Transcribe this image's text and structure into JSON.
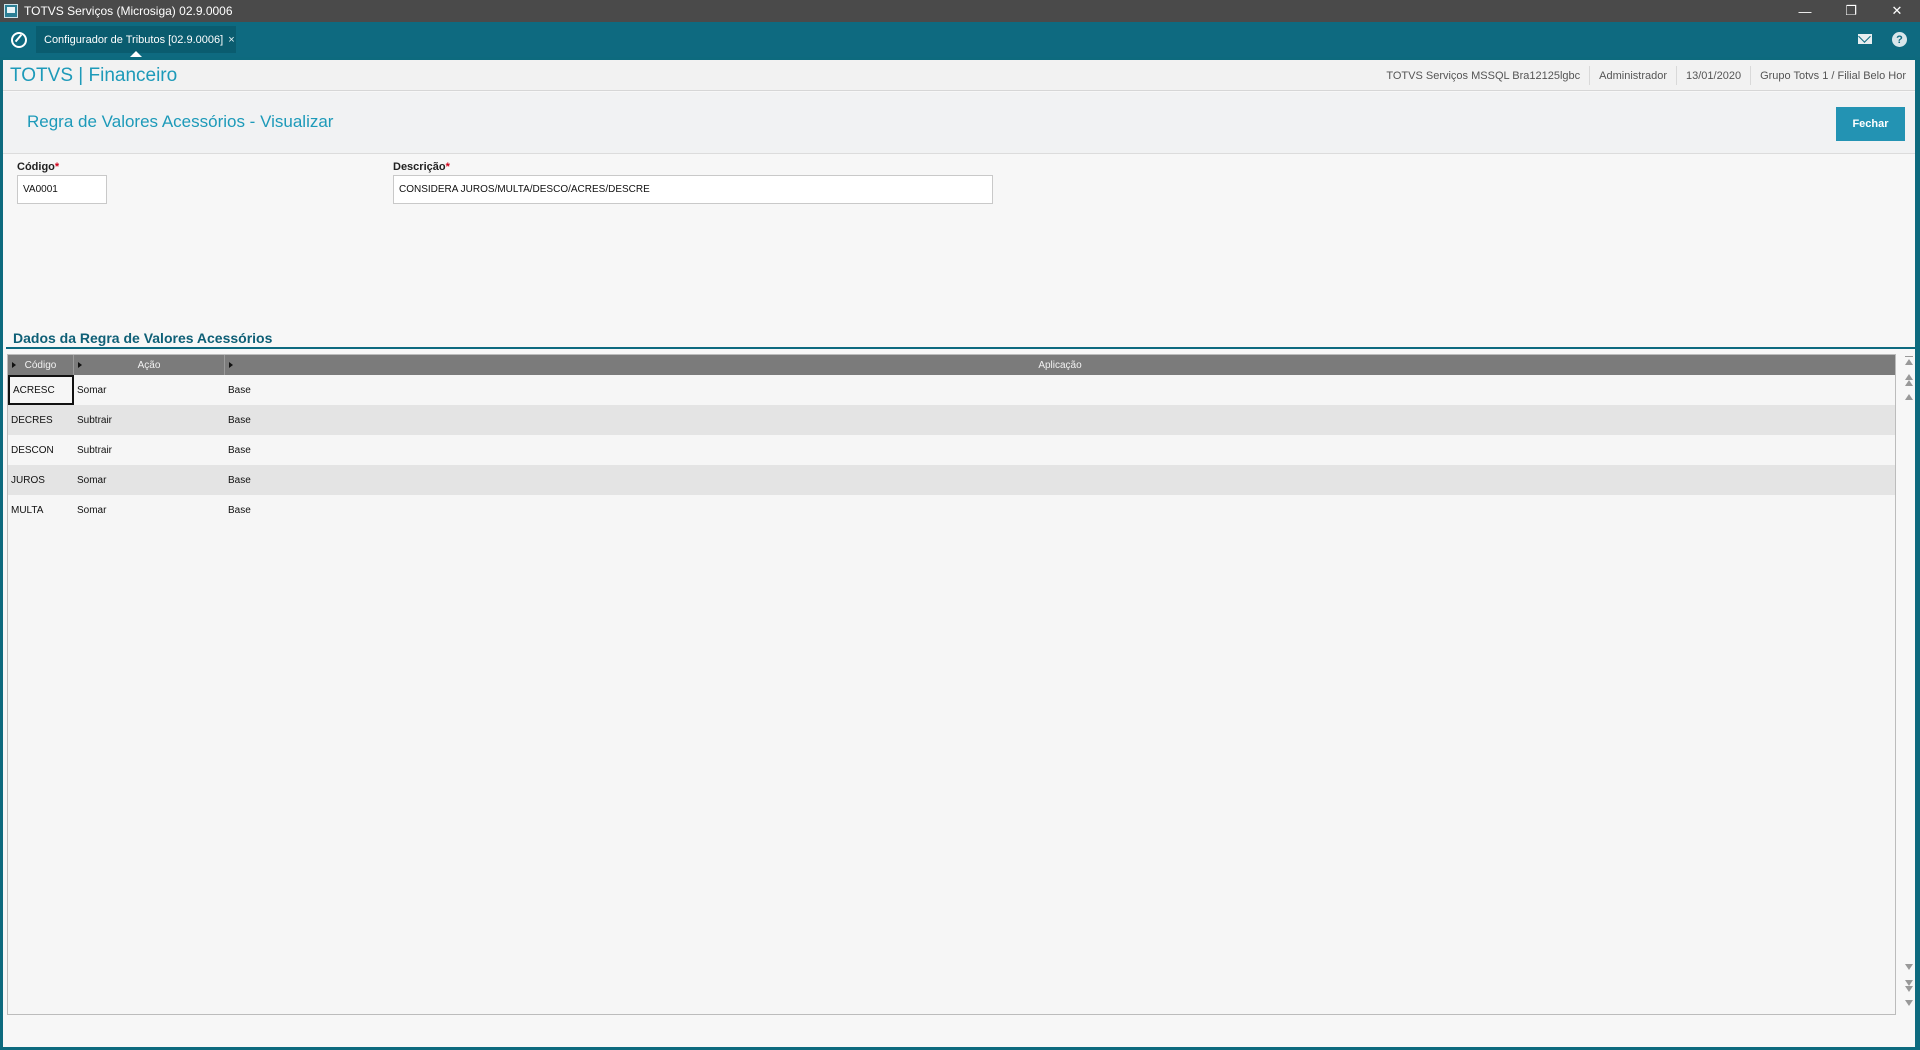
{
  "window": {
    "title": "TOTVS Serviços (Microsiga) 02.9.0006",
    "minimize": "—",
    "restore": "❐",
    "close": "✕"
  },
  "tabs": [
    {
      "label": "Configurador de Tributos [02.9.0006]",
      "close": "×"
    }
  ],
  "header": {
    "brand": "TOTVS | Financeiro",
    "environment": "TOTVS Serviços MSSQL Bra12125lgbc",
    "user": "Administrador",
    "date": "13/01/2020",
    "branch": "Grupo Totvs 1 / Filial Belo Hor"
  },
  "page": {
    "title": "Regra de Valores Acessórios - Visualizar",
    "close_button": "Fechar"
  },
  "form": {
    "codigo": {
      "label": "Código",
      "required_mark": "*",
      "value": "VA0001"
    },
    "descricao": {
      "label": "Descrição",
      "required_mark": "*",
      "value": "CONSIDERA JUROS/MULTA/DESCO/ACRES/DESCRE"
    }
  },
  "section": {
    "title": "Dados da Regra de Valores Acessórios"
  },
  "grid": {
    "columns": [
      "Código",
      "Ação",
      "Aplicação"
    ],
    "rows": [
      {
        "codigo": "ACRESC",
        "acao": "Somar",
        "aplicacao": "Base"
      },
      {
        "codigo": "DECRES",
        "acao": "Subtrair",
        "aplicacao": "Base"
      },
      {
        "codigo": "DESCON",
        "acao": "Subtrair",
        "aplicacao": "Base"
      },
      {
        "codigo": "JUROS",
        "acao": "Somar",
        "aplicacao": "Base"
      },
      {
        "codigo": "MULTA",
        "acao": "Somar",
        "aplicacao": "Base"
      }
    ]
  },
  "icons": {
    "app": "app-window-icon",
    "home": "totvs-home-icon",
    "mail": "mail-icon",
    "help": "help-icon",
    "help_glyph": "?"
  },
  "colors": {
    "accent": "#1d9ab9",
    "tabbar": "#0e6a80",
    "button": "#2393b3",
    "required": "#d0021b"
  }
}
